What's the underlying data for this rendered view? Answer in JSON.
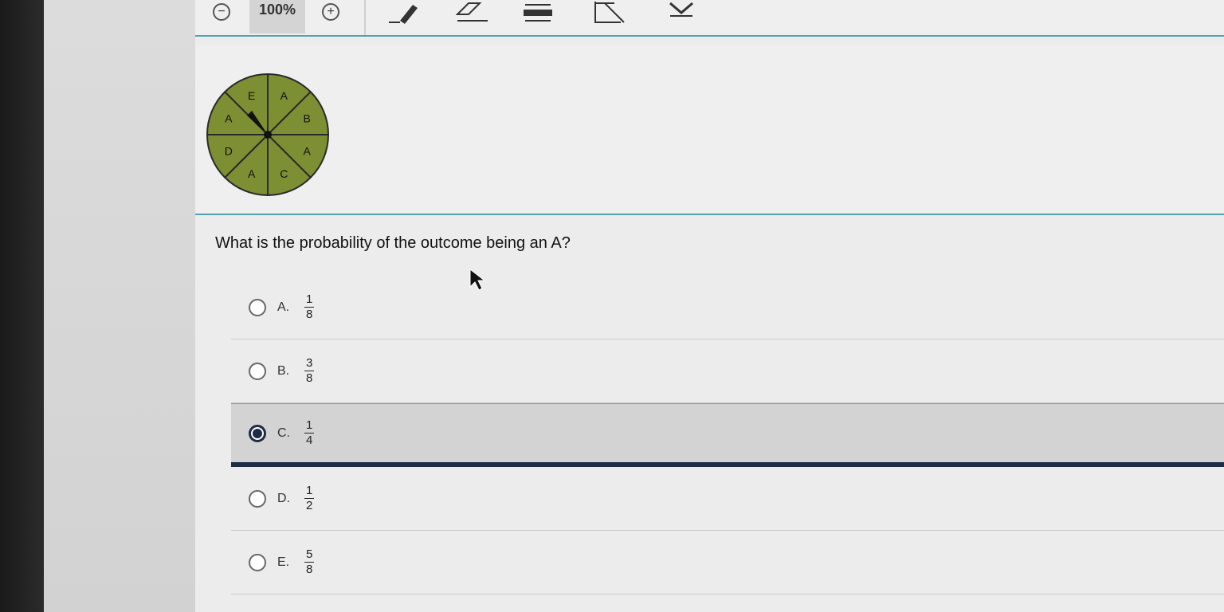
{
  "toolbar": {
    "zoom_level": "100%",
    "zoom_out_glyph": "−",
    "zoom_in_glyph": "+",
    "icons": [
      "zoom-out-icon",
      "zoom-in-icon",
      "pen-icon",
      "eraser-icon",
      "lines-icon",
      "graph-icon",
      "collapse-icon"
    ]
  },
  "figure": {
    "spinner": {
      "labels": [
        "A",
        "B",
        "A",
        "C",
        "A",
        "D",
        "A",
        "E"
      ],
      "fill_color": "#7d8f33",
      "line_color": "#2a2a2a"
    }
  },
  "question": {
    "text": "What is the probability of the outcome being an A?"
  },
  "choices": [
    {
      "letter": "A.",
      "numerator": "1",
      "denominator": "8",
      "selected": false
    },
    {
      "letter": "B.",
      "numerator": "3",
      "denominator": "8",
      "selected": false
    },
    {
      "letter": "C.",
      "numerator": "1",
      "denominator": "4",
      "selected": true
    },
    {
      "letter": "D.",
      "numerator": "1",
      "denominator": "2",
      "selected": false
    },
    {
      "letter": "E.",
      "numerator": "5",
      "denominator": "8",
      "selected": false
    }
  ],
  "colors": {
    "accent": "#4fa3b5",
    "selected_border": "#1e2c44"
  }
}
